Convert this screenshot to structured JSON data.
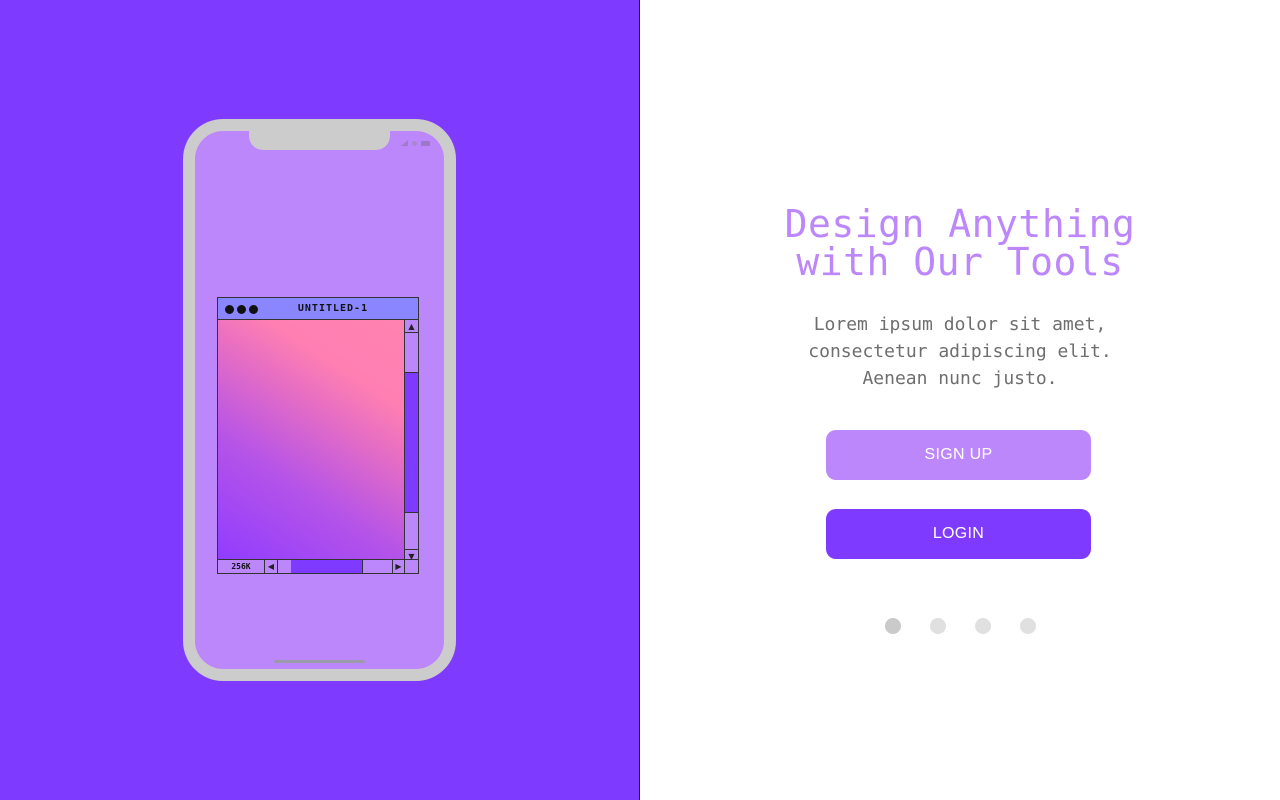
{
  "hero": {
    "title_lines": [
      "Design Anything",
      "with Our Tools"
    ],
    "subtitle_lines": [
      "Lorem ipsum dolor sit amet,",
      "consectetur adipiscing elit.",
      "Aenean nunc justo."
    ]
  },
  "buttons": {
    "signup_label": "SIGN UP",
    "login_label": "LOGIN"
  },
  "pager": {
    "total": 4,
    "active_index": 0
  },
  "app_window": {
    "title": "UNTITLED-1",
    "zoom_label": "256K",
    "scroll_up_glyph": "▲",
    "scroll_down_glyph": "▼",
    "scroll_left_glyph": "◀",
    "scroll_right_glyph": "▶"
  },
  "icons": {
    "status": [
      "signal-icon",
      "wifi-icon",
      "battery-icon"
    ]
  },
  "colors": {
    "brand_purple": "#7f3aff",
    "light_purple": "#bd87fc",
    "titlebar_blue": "#8a86ff",
    "phone_frame": "#cccccc",
    "gradient_pink": "#ff82b0"
  }
}
